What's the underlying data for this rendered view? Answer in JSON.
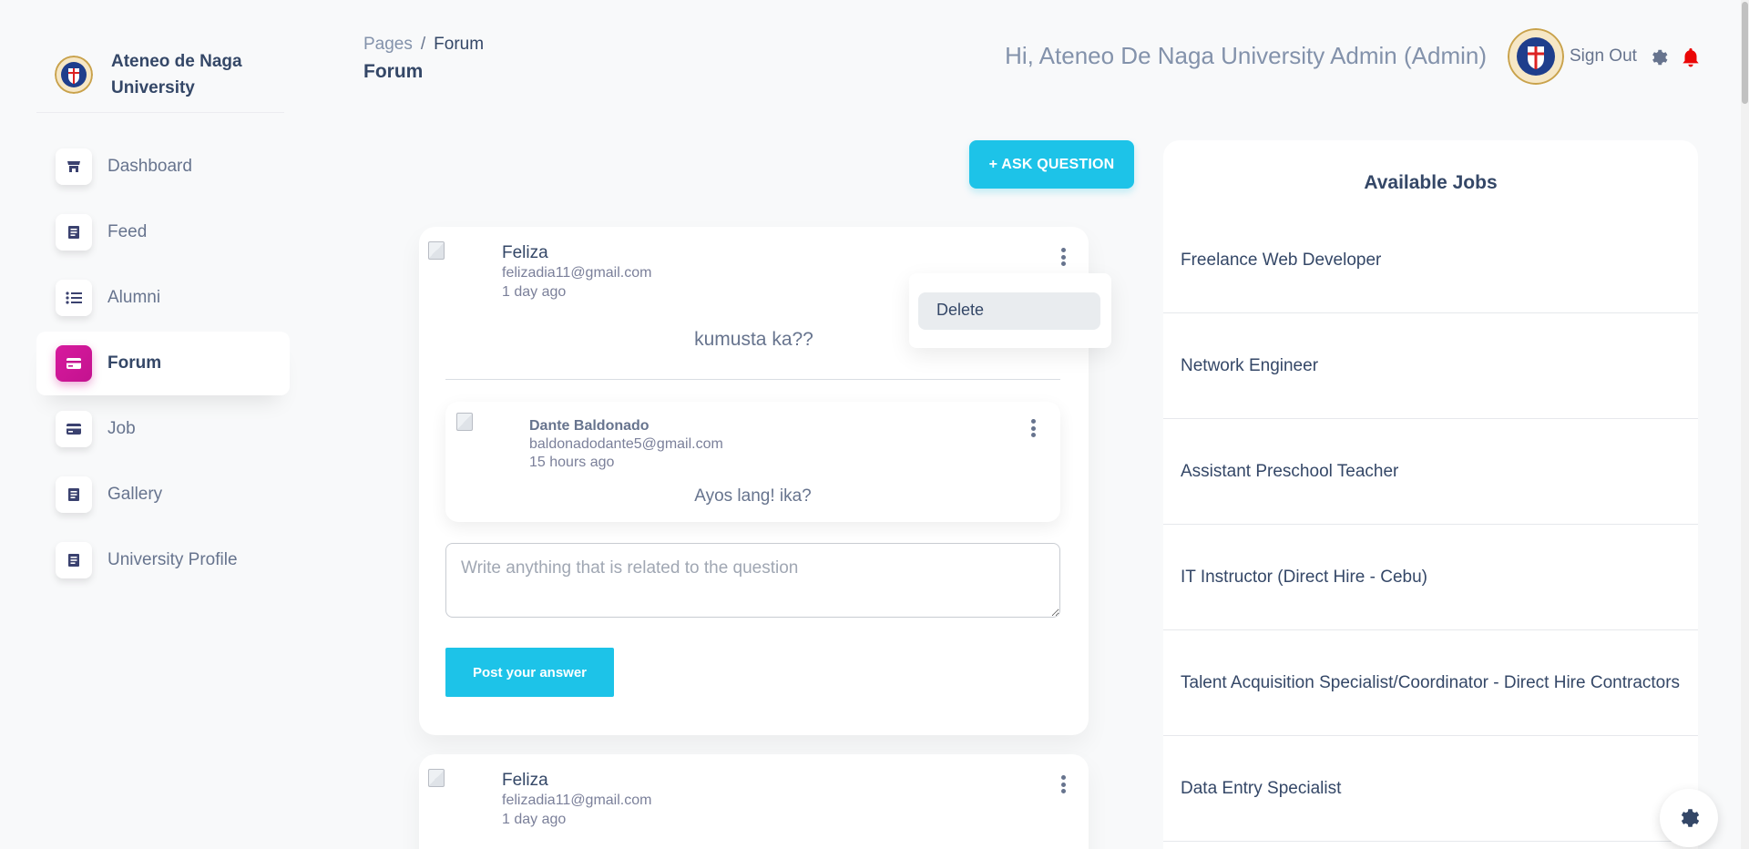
{
  "sidebar": {
    "brand": "Ateneo de Naga University",
    "items": [
      {
        "label": "Dashboard",
        "icon": "shop-icon"
      },
      {
        "label": "Feed",
        "icon": "document-icon"
      },
      {
        "label": "Alumni",
        "icon": "list-icon"
      },
      {
        "label": "Forum",
        "icon": "credit-card-icon",
        "active": true
      },
      {
        "label": "Job",
        "icon": "credit-card-icon"
      },
      {
        "label": "Gallery",
        "icon": "document-icon"
      },
      {
        "label": "University Profile",
        "icon": "document-icon"
      }
    ]
  },
  "header": {
    "breadcrumb_root": "Pages",
    "breadcrumb_sep": "/",
    "breadcrumb_current": "Forum",
    "title": "Forum",
    "greeting": "Hi, Ateneo De Naga University Admin (Admin)",
    "sign_out": "Sign Out"
  },
  "forum": {
    "ask_button": "+ ASK QUESTION",
    "questions": [
      {
        "author": "Feliza",
        "email": "felizadia11@gmail.com",
        "time": "1 day ago",
        "text": "kumusta ka??",
        "menu_item": "Delete",
        "answers": [
          {
            "author": "Dante Baldonado",
            "email": "baldonadodante5@gmail.com",
            "time": "15 hours ago",
            "text": "Ayos lang! ika?"
          }
        ],
        "answer_placeholder": "Write anything that is related to the question",
        "post_button": "Post your answer"
      },
      {
        "author": "Feliza",
        "email": "felizadia11@gmail.com",
        "time": "1 day ago"
      }
    ]
  },
  "jobs": {
    "title": "Available Jobs",
    "items": [
      "Freelance Web Developer",
      "Network Engineer",
      "Assistant Preschool Teacher",
      "IT Instructor (Direct Hire - Cebu)",
      "Talent Acquisition Specialist/Coordinator - Direct Hire Contractors",
      "Data Entry Specialist"
    ]
  },
  "colors": {
    "accent": "#1dc3e8",
    "active_nav": "#d0159a",
    "text_dark": "#344767",
    "text_muted": "#67748e",
    "bell": "#ea0606"
  }
}
